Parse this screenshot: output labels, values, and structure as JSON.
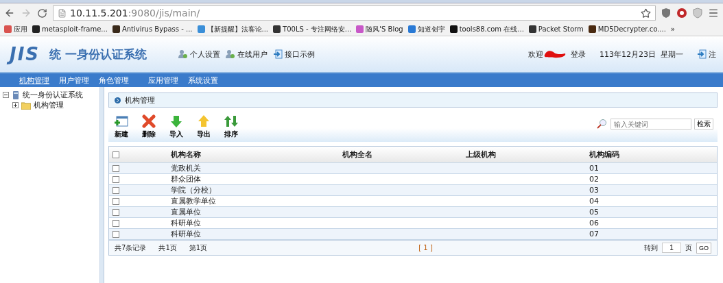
{
  "browser": {
    "url_host": "10.11.5.201",
    "url_rest": ":9080/jis/main/",
    "bookmarks": [
      {
        "label": "应用",
        "color": "#d9534f"
      },
      {
        "label": "metasploit-frame...",
        "color": "#222222"
      },
      {
        "label": "Antivirus Bypass - ...",
        "color": "#3a2a1a"
      },
      {
        "label": "【新提醒】法客论...",
        "color": "#3b8fd8"
      },
      {
        "label": "T00LS - 专注网络安...",
        "color": "#333333"
      },
      {
        "label": "随风'S Blog",
        "color": "#c858c8"
      },
      {
        "label": "知道创宇",
        "color": "#2a7ad5"
      },
      {
        "label": "tools88.com 在线...",
        "color": "#111111"
      },
      {
        "label": "Packet Storm",
        "color": "#333333"
      },
      {
        "label": "MD5Decrypter.co....",
        "color": "#4a2a10"
      }
    ],
    "more": "»"
  },
  "header": {
    "logo": "JIS",
    "title": "统 一身份认证系统",
    "links": [
      "个人设置",
      "在线用户",
      "接口示例"
    ],
    "welcome": "欢迎",
    "login": "登录",
    "date": "113年12月23日  星期一",
    "logout": "注"
  },
  "nav": [
    {
      "label": "机构管理",
      "selected": true
    },
    {
      "label": "用户管理",
      "selected": false
    },
    {
      "label": "角色管理",
      "selected": false
    },
    {
      "label": "应用管理",
      "selected": false
    },
    {
      "label": "系统设置",
      "selected": false
    }
  ],
  "tree": {
    "label": "统一身份认证系统",
    "expanded": true,
    "children": [
      {
        "label": "机构管理",
        "expanded": false
      }
    ]
  },
  "panel_title": "机构管理",
  "toolbar": [
    {
      "kind": "new",
      "label": "新建"
    },
    {
      "kind": "delete",
      "label": "删除"
    },
    {
      "kind": "import",
      "label": "导入"
    },
    {
      "kind": "export",
      "label": "导出"
    },
    {
      "kind": "sort",
      "label": "排序"
    }
  ],
  "search": {
    "placeholder": "输入关键词",
    "button": "检索"
  },
  "table": {
    "select_all_checked": false,
    "columns": [
      "机构名称",
      "机构全名",
      "上级机构",
      "机构编码"
    ],
    "rows": [
      {
        "checked": false,
        "cells": [
          "党政机关",
          "",
          "",
          "01"
        ]
      },
      {
        "checked": false,
        "cells": [
          "群众团体",
          "",
          "",
          "02"
        ]
      },
      {
        "checked": false,
        "cells": [
          "学院（分校）",
          "",
          "",
          "03"
        ]
      },
      {
        "checked": false,
        "cells": [
          "直属教学单位",
          "",
          "",
          "04"
        ]
      },
      {
        "checked": false,
        "cells": [
          "直属单位",
          "",
          "",
          "05"
        ]
      },
      {
        "checked": false,
        "cells": [
          "科研单位",
          "",
          "",
          "06"
        ]
      },
      {
        "checked": false,
        "cells": [
          "科研单位",
          "",
          "",
          "07"
        ]
      }
    ]
  },
  "pager": {
    "total": "共7条记录",
    "pages": "共1页",
    "current": "第1页",
    "page_link": "[ 1 ]",
    "goto": "转到",
    "page_input": "1",
    "page_unit": "页",
    "go": "GO"
  }
}
